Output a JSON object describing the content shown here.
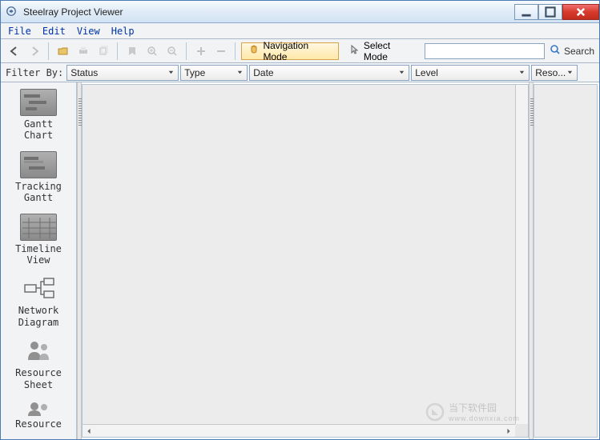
{
  "window": {
    "title": "Steelray Project Viewer"
  },
  "menu": {
    "file": "File",
    "edit": "Edit",
    "view": "View",
    "help": "Help"
  },
  "toolbar": {
    "nav_mode": "Navigation Mode",
    "select_mode": "Select Mode",
    "search_placeholder": "",
    "search_label": "Search"
  },
  "filter": {
    "label": "Filter By:",
    "status": "Status",
    "type": "Type",
    "date": "Date",
    "level": "Level",
    "reso": "Reso..."
  },
  "sidebar": {
    "items": [
      {
        "label": "Gantt\nChart"
      },
      {
        "label": "Tracking\nGantt"
      },
      {
        "label": "Timeline View"
      },
      {
        "label": "Network\nDiagram"
      },
      {
        "label": "Resource\nSheet"
      },
      {
        "label": "Resource"
      }
    ]
  },
  "watermark": {
    "text": "当下软件园",
    "url": "www.downxia.com"
  }
}
